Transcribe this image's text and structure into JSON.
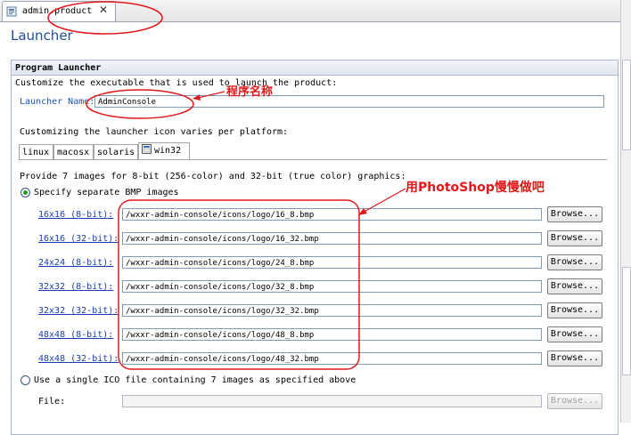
{
  "editor_tab": {
    "label": "admin.product",
    "icon": "product-file-icon",
    "close_glyph": "✕"
  },
  "page_title": "Launcher",
  "section": {
    "title": "Program Launcher",
    "description": "Customize the executable that is used to launch the product:",
    "launcher_name_label": "Launcher Name:",
    "launcher_name_value": "AdminConsole",
    "platform_caption": "Customizing the launcher icon varies per platform:",
    "platform_tabs": [
      "linux",
      "macosx",
      "solaris",
      "win32"
    ],
    "active_platform": "win32",
    "images_caption": "Provide 7 images for 8-bit (256-color) and 32-bit (true color) graphics:",
    "option_separate": "Specify separate BMP images",
    "option_single": "Use a single ICO file containing 7 images as specified above",
    "selected_option": "separate",
    "bmp_rows": [
      {
        "label": "16x16  (8-bit):",
        "path": "/wxxr-admin-console/icons/logo/16_8.bmp",
        "button": "Browse..."
      },
      {
        "label": "16x16  (32-bit):",
        "path": "/wxxr-admin-console/icons/logo/16_32.bmp",
        "button": "Browse..."
      },
      {
        "label": "24x24  (8-bit):",
        "path": "/wxxr-admin-console/icons/logo/24_8.bmp",
        "button": "Browse..."
      },
      {
        "label": "32x32  (8-bit):",
        "path": "/wxxr-admin-console/icons/logo/32_8.bmp",
        "button": "Browse..."
      },
      {
        "label": "32x32  (32-bit):",
        "path": "/wxxr-admin-console/icons/logo/32_32.bmp",
        "button": "Browse..."
      },
      {
        "label": "48x48  (8-bit):",
        "path": "/wxxr-admin-console/icons/logo/48_8.bmp",
        "button": "Browse..."
      },
      {
        "label": "48x48  (32-bit):",
        "path": "/wxxr-admin-console/icons/logo/48_32.bmp",
        "button": "Browse..."
      }
    ],
    "file_label": "File:",
    "file_value": "",
    "file_button": "Browse..."
  },
  "annotations": {
    "launcher_name_note": "程序名称",
    "images_note": "用PhotoShop慢慢做吧",
    "color": "#e0181b"
  },
  "colors": {
    "title_blue": "#1f4e99",
    "link_blue": "#1a3fb0",
    "radio_green": "#1e9a1e"
  }
}
